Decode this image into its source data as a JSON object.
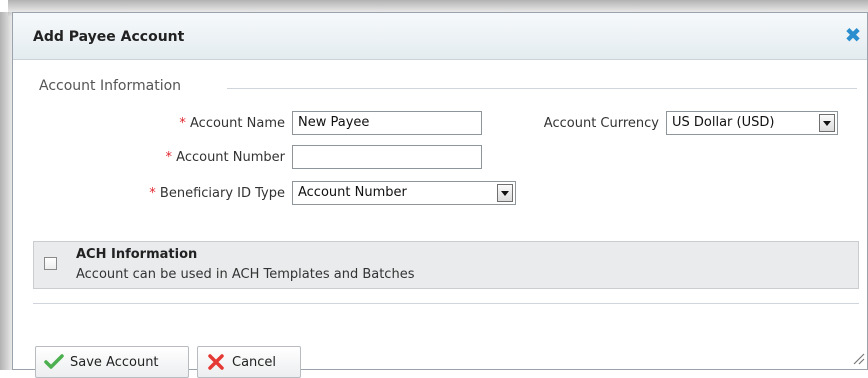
{
  "dialog": {
    "title": "Add Payee Account",
    "close_icon": "close-icon"
  },
  "account_info": {
    "legend": "Account Information",
    "required_marker": "*",
    "account_name": {
      "label": "Account Name",
      "value": "New Payee"
    },
    "account_number": {
      "label": "Account Number",
      "value": ""
    },
    "beneficiary_id_type": {
      "label": "Beneficiary ID Type",
      "selected": "Account Number"
    },
    "account_currency": {
      "label": "Account Currency",
      "selected": "US Dollar (USD)"
    }
  },
  "ach": {
    "checked": false,
    "title": "ACH Information",
    "subtitle": "Account can be used in ACH Templates and Batches"
  },
  "buttons": {
    "save_label": "Save Account",
    "save_icon": "checkmark-icon",
    "cancel_label": "Cancel",
    "cancel_icon": "x-icon"
  },
  "colors": {
    "accent": "#2b8fcf",
    "required": "#e0262e",
    "save_icon": "#4caf50",
    "cancel_icon": "#e53935"
  }
}
